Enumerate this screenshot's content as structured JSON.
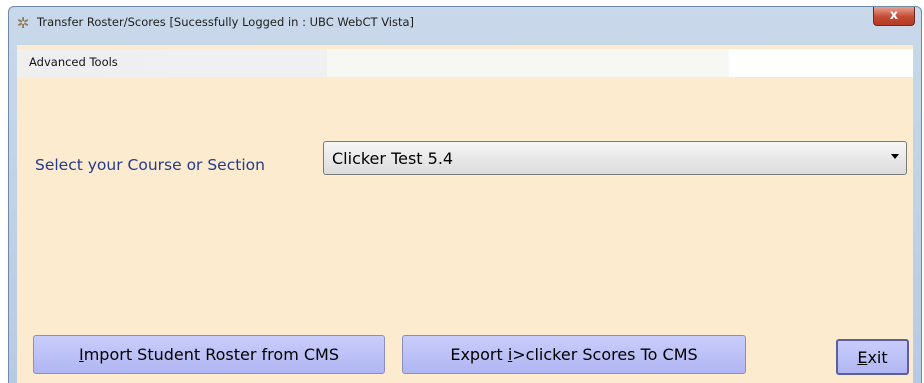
{
  "window": {
    "title": "Transfer Roster/Scores [Sucessfully Logged in : UBC WebCT Vista]",
    "close_symbol": "x"
  },
  "menu": {
    "items": [
      {
        "label": "Advanced Tools"
      }
    ]
  },
  "course": {
    "label": "Select your Course or Section",
    "selected": "Clicker Test 5.4"
  },
  "buttons": {
    "import": {
      "mnemonic": "I",
      "rest": "mport Student Roster from CMS"
    },
    "export": {
      "pre": "Export ",
      "mnemonic": "i",
      "rest": ">clicker Scores To CMS"
    },
    "exit": {
      "mnemonic": "E",
      "rest": "xit"
    }
  },
  "icons": {
    "app": "gear-icon",
    "close": "close-icon",
    "dropdown": "chevron-down-icon"
  },
  "colors": {
    "client_bg": "#fdebd0",
    "button_bg": "#c1c5f8",
    "label_text": "#243a8a",
    "close_red": "#c64a33"
  }
}
